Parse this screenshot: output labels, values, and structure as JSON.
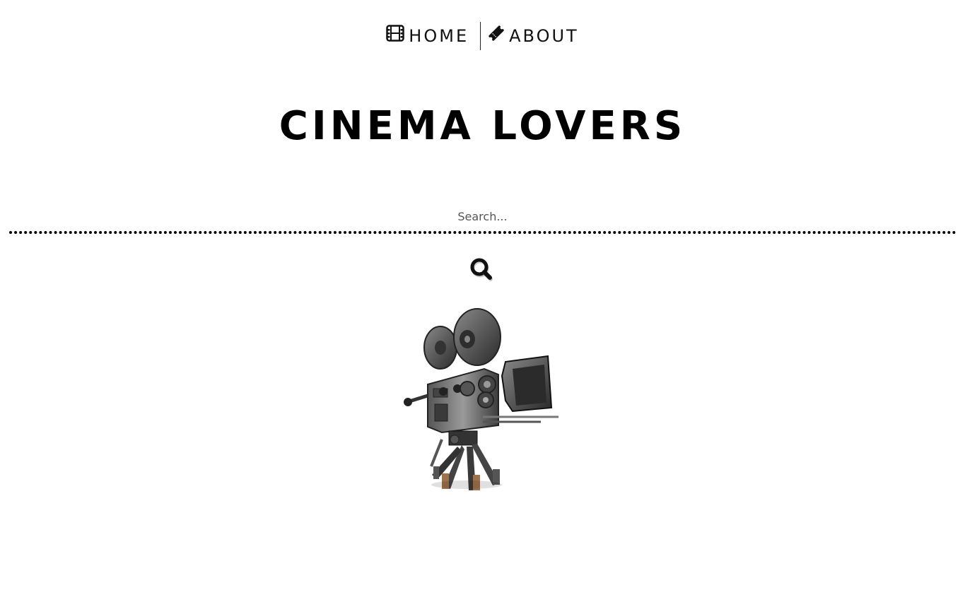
{
  "nav": {
    "home": {
      "label": "HOME",
      "icon": "film-icon"
    },
    "about": {
      "label": "ABOUT",
      "icon": "ticket-icon"
    }
  },
  "header": {
    "title": "CINEMA LOVERS"
  },
  "search": {
    "placeholder": "Search...",
    "value": "",
    "button_icon": "search-icon"
  },
  "hero": {
    "image": "vintage-movie-camera",
    "alt": "Vintage movie camera on tripod"
  },
  "colors": {
    "text": "#111111",
    "background": "#ffffff",
    "camera_body": "#3a3a3a",
    "tripod_feet": "#a0724a"
  }
}
